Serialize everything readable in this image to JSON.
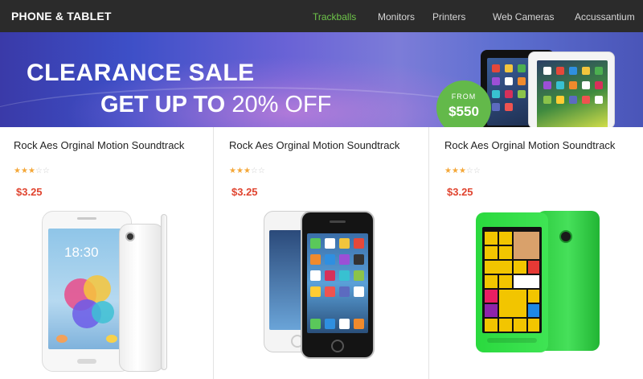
{
  "header": {
    "brand": "PHONE & TABLET",
    "nav": [
      {
        "label": "Trackballs",
        "active": true
      },
      {
        "label": "Monitors",
        "active": false
      },
      {
        "label": "Printers",
        "active": false
      },
      {
        "label": "Web Cameras",
        "active": false
      },
      {
        "label": "Accussantium",
        "active": false
      }
    ]
  },
  "banner": {
    "line1": "CLEARANCE SALE",
    "line2_bold": "GET UP TO",
    "line2_light": "20% OFF",
    "badge_from": "FROM",
    "badge_price": "$550"
  },
  "products": [
    {
      "title": "Rock Aes Orginal Motion Soundtrack",
      "rating": 3,
      "max_rating": 5,
      "price": "$3.25",
      "image": "white-android-phone"
    },
    {
      "title": "Rock Aes Orginal Motion Soundtrack",
      "rating": 3,
      "max_rating": 5,
      "price": "$3.25",
      "image": "iphone-pair"
    },
    {
      "title": "Rock Aes Orginal Motion Soundtrack",
      "rating": 3,
      "max_rating": 5,
      "price": "$3.25",
      "image": "green-lumia-phone"
    }
  ],
  "colors": {
    "topbar": "#2b2b2b",
    "nav_active": "#6ec54a",
    "price": "#e0442f",
    "star": "#f4a83a",
    "badge": "#63b94a"
  }
}
